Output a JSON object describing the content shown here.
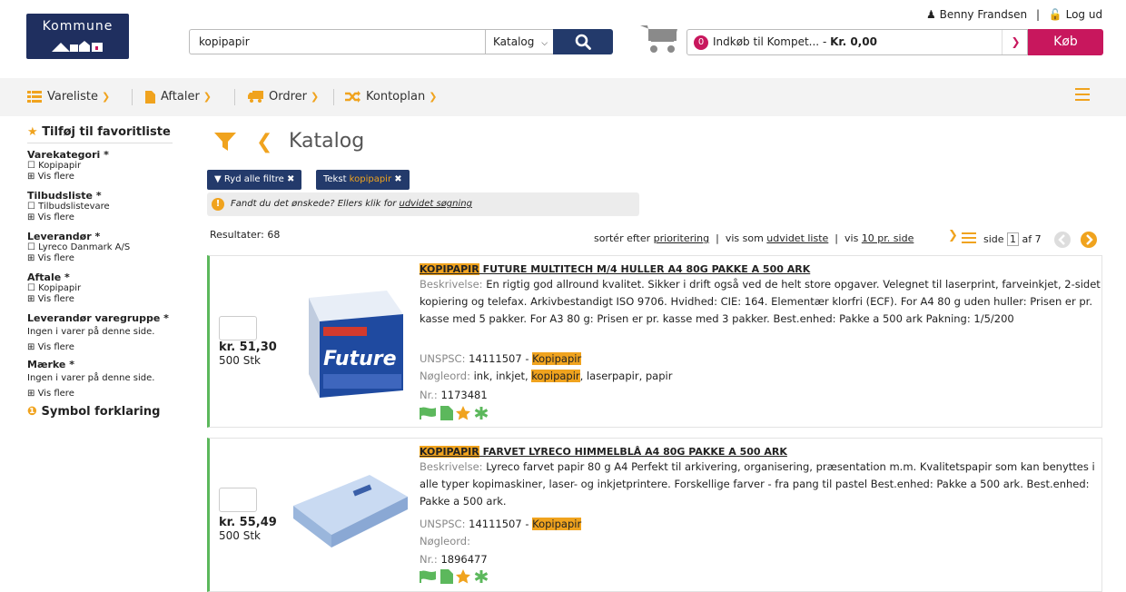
{
  "header": {
    "logo_text": "Kommune",
    "search_value": "kopipapir",
    "search_scope": "Katalog",
    "cart_count": "0",
    "cart_label": "Indkøb til Kompet...",
    "cart_sep": " - ",
    "cart_amount": "Kr. 0,00",
    "buy_label": "Køb",
    "user_name": "Benny Frandsen",
    "user_sep": "|",
    "logout_label": "Log ud"
  },
  "nav": {
    "items": [
      {
        "label": "Vareliste",
        "icon": "list-icon"
      },
      {
        "label": "Aftaler",
        "icon": "document-icon"
      },
      {
        "label": "Ordrer",
        "icon": "truck-icon"
      },
      {
        "label": "Kontoplan",
        "icon": "shuffle-icon"
      }
    ]
  },
  "sidebar": {
    "favorites": "Tilføj til favoritliste",
    "sections": [
      {
        "title": "Varekategori",
        "req": " *",
        "item": "Kopipapir",
        "more": "Vis flere"
      },
      {
        "title": "Tilbudsliste",
        "req": " *",
        "item": "Tilbudslistevare",
        "more": "Vis flere"
      },
      {
        "title": "Leverandør",
        "req": " *",
        "item": "Lyreco Danmark A/S",
        "more": "Vis flere"
      },
      {
        "title": "Aftale",
        "req": " *",
        "item": "Kopipapir",
        "more": "Vis flere"
      },
      {
        "title": "Leverandør varegruppe",
        "req": " *",
        "text": "Ingen i varer på denne side.",
        "more": "Vis flere"
      },
      {
        "title": "Mærke",
        "req": " *",
        "text": "Ingen i varer på denne side.",
        "more": "Vis flere"
      }
    ],
    "legend": "Symbol forklaring"
  },
  "main": {
    "title": "Katalog",
    "chips": [
      {
        "label": "Ryd alle filtre"
      },
      {
        "prefix": "Tekst ",
        "value": "kopipapir"
      }
    ],
    "notice": "Fandt du det ønskede? Ellers klik for ",
    "notice_link": "udvidet søgning",
    "results": "Resultater: 68",
    "sort_prefix": "sortér efter ",
    "sort_link": "prioritering",
    "view_prefix": "  |  vis som ",
    "view_link": "udvidet liste",
    "per_prefix": "  |  vis ",
    "per_link": "10 pr. side",
    "page_prefix": "side",
    "page_current": "1",
    "page_total": "af 7"
  },
  "products": [
    {
      "title_hl": "KOPIPAPIR",
      "title_rest": " FUTURE MULTITECH M/4 HULLER A4 80G PAKKE A 500 ARK",
      "desc_label": "Beskrivelse:",
      "desc": " En rigtig god allround kvalitet. Sikker i drift også ved de helt store opgaver. Velegnet til laserprint, farveinkjet, 2-sidet kopiering og telefax. Arkivbestandigt ISO 9706. Hvidhed: CIE: 164. Elementær klorfri (ECF). For A4 80 g uden huller: Prisen er pr. kasse med 5 pakker. For A3 80 g: Prisen er pr. kasse med 3 pakker. Best.enhed: Pakke a 500 ark Pakning: 1/5/200",
      "unspsc_label": "UNSPSC:",
      "unspsc": " 14111507 - ",
      "unspsc_hl": "Kopipapir",
      "kw_label": "Nøgleord:",
      "kw_pre": " ink, inkjet, ",
      "kw_hl": "kopipapir",
      "kw_post": ", laserpapir, papir",
      "nr_label": "Nr.:",
      "nr": " 1173481",
      "price": "kr. 51,30",
      "unit": "500 Stk",
      "img_text": "Future"
    },
    {
      "title_hl": "KOPIPAPIR",
      "title_rest": " FARVET LYRECO HIMMELBLÅ A4 80G PAKKE A 500 ARK",
      "desc_label": "Beskrivelse:",
      "desc": " Lyreco farvet papir 80 g A4 Perfekt til arkivering, organisering, præsentation m.m. Kvalitetspapir som kan benyttes i alle typer kopimaskiner, laser- og inkjetprintere. Forskellige farver - fra pang til pastel Best.enhed: Pakke a 500 ark. Best.enhed: Pakke a 500 ark.",
      "unspsc_label": "UNSPSC:",
      "unspsc": " 14111507 - ",
      "unspsc_hl": "Kopipapir",
      "kw_label": "Nøgleord:",
      "nr_label": "Nr.:",
      "nr": " 1896477",
      "price": "kr. 55,49",
      "unit": "500 Stk"
    }
  ],
  "colors": {
    "navy": "#233a6b",
    "accent": "#f0a31e",
    "pink": "#c8175d",
    "green": "#5cb85c"
  }
}
